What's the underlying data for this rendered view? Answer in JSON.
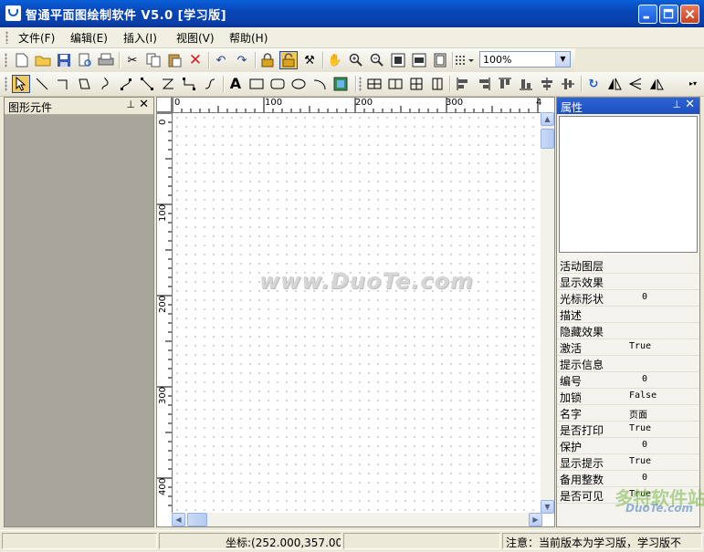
{
  "window": {
    "title": "智通平面图绘制软件  V5.0 [学习版]"
  },
  "menu": [
    "文件(F)",
    "编辑(E)",
    "插入(I)",
    "视图(V)",
    "帮助(H)"
  ],
  "toolbar": {
    "zoom_value": "100%"
  },
  "left_panel": {
    "title": "图形元件"
  },
  "ruler": {
    "h_labels": [
      "0",
      "100",
      "200",
      "300",
      "400"
    ],
    "v_labels": [
      "0",
      "100",
      "200",
      "300",
      "400"
    ]
  },
  "watermark": "www.DuoTe.com",
  "properties": {
    "title": "属性",
    "rows": [
      {
        "name": "活动图层",
        "value": ""
      },
      {
        "name": "显示效果",
        "value": ""
      },
      {
        "name": "光标形状",
        "value": "0"
      },
      {
        "name": "描述",
        "value": ""
      },
      {
        "name": "隐藏效果",
        "value": ""
      },
      {
        "name": "激活",
        "value": "True"
      },
      {
        "name": "提示信息",
        "value": ""
      },
      {
        "name": "编号",
        "value": "0"
      },
      {
        "name": "加锁",
        "value": "False"
      },
      {
        "name": "名字",
        "value": "页面"
      },
      {
        "name": "是否打印",
        "value": "True"
      },
      {
        "name": "保护",
        "value": "0"
      },
      {
        "name": "显示提示",
        "value": "True"
      },
      {
        "name": "备用整数",
        "value": "0"
      },
      {
        "name": "是否可见",
        "value": "True"
      }
    ]
  },
  "status": {
    "coords": "坐标:(252.000,357.000)",
    "notice": "注意：当前版本为学习版，学习版不"
  },
  "site_logo": {
    "line1": "多特软件站",
    "line2": "DuoTe.com"
  }
}
